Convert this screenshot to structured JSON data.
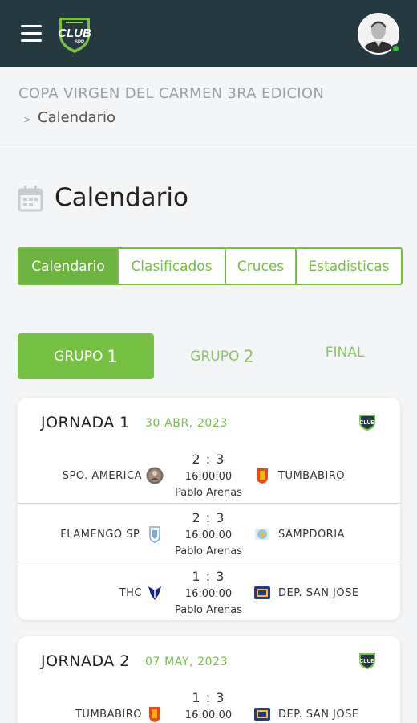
{
  "header": {
    "logo_text": "CLUB",
    "logo_subtext": "SPP"
  },
  "breadcrumb": {
    "title": "COPA VIRGEN DEL CARMEN 3RA EDICION",
    "separator": ">",
    "current": "Calendario"
  },
  "page_title": "Calendario",
  "tabs": [
    {
      "label": "Calendario",
      "active": true
    },
    {
      "label": "Clasificados",
      "active": false
    },
    {
      "label": "Cruces",
      "active": false
    },
    {
      "label": "Estadisticas",
      "active": false
    }
  ],
  "groups": [
    {
      "label": "GRUPO",
      "num": "1",
      "active": true
    },
    {
      "label": "GRUPO",
      "num": "2",
      "active": false
    },
    {
      "label": "FINAL",
      "num": "",
      "active": false
    }
  ],
  "jornadas": [
    {
      "title": "JORNADA 1",
      "date": "30 ABR, 2023",
      "matches": [
        {
          "home": "SPO. AMERICA",
          "away": "TUMBABIRO",
          "score": "2 : 3",
          "time": "16:00:00",
          "venue": "Pablo Arenas"
        },
        {
          "home": "FLAMENGO SP.",
          "away": "SAMPDORIA",
          "score": "2 : 3",
          "time": "16:00:00",
          "venue": "Pablo Arenas"
        },
        {
          "home": "THC",
          "away": "DEP. SAN JOSE",
          "score": "1 : 3",
          "time": "16:00:00",
          "venue": "Pablo Arenas"
        }
      ]
    },
    {
      "title": "JORNADA 2",
      "date": "07 MAY, 2023",
      "matches": [
        {
          "home": "TUMBABIRO",
          "away": "DEP. SAN JOSE",
          "score": "1 : 3",
          "time": "16:00:00",
          "venue": ""
        }
      ]
    }
  ],
  "colors": {
    "topbar": "#243a40",
    "accent": "#76c043",
    "accent_dark": "#6db33f",
    "online": "#2fc43a"
  },
  "icons": {
    "menu": "hamburger-menu-icon",
    "calendar": "calendar-icon"
  }
}
